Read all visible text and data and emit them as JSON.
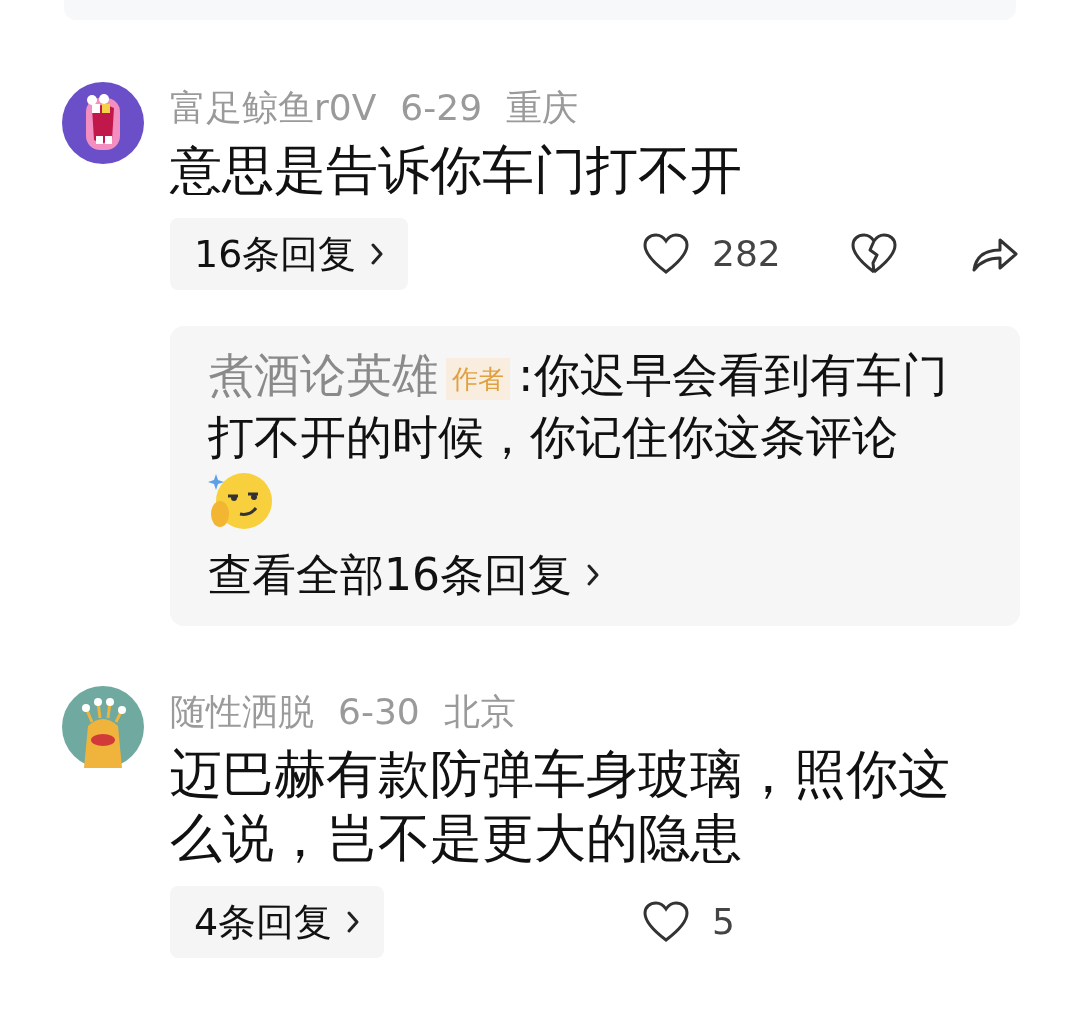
{
  "comments": [
    {
      "avatar": {
        "kind": "mouth"
      },
      "username": "富足鲸鱼r0V",
      "date": "6-29",
      "location": "重庆",
      "text": "意思是告诉你车门打不开",
      "replies_button": "16条回复",
      "likes": "282",
      "show_dislike": true,
      "show_share": true,
      "reply_preview": {
        "author": "煮酒论英雄",
        "badge": "作者",
        "separator": ":",
        "text": "你迟早会看到有车门打不开的时候，你记住你这条评论",
        "emoji": true,
        "view_all": "查看全部16条回复"
      }
    },
    {
      "avatar": {
        "kind": "monster"
      },
      "username": "随性洒脱",
      "date": "6-30",
      "location": "北京",
      "text": "迈巴赫有款防弹车身玻璃，照你这么说，岂不是更大的隐患",
      "replies_button": "4条回复",
      "likes": "5",
      "show_dislike": false,
      "show_share": false
    }
  ]
}
